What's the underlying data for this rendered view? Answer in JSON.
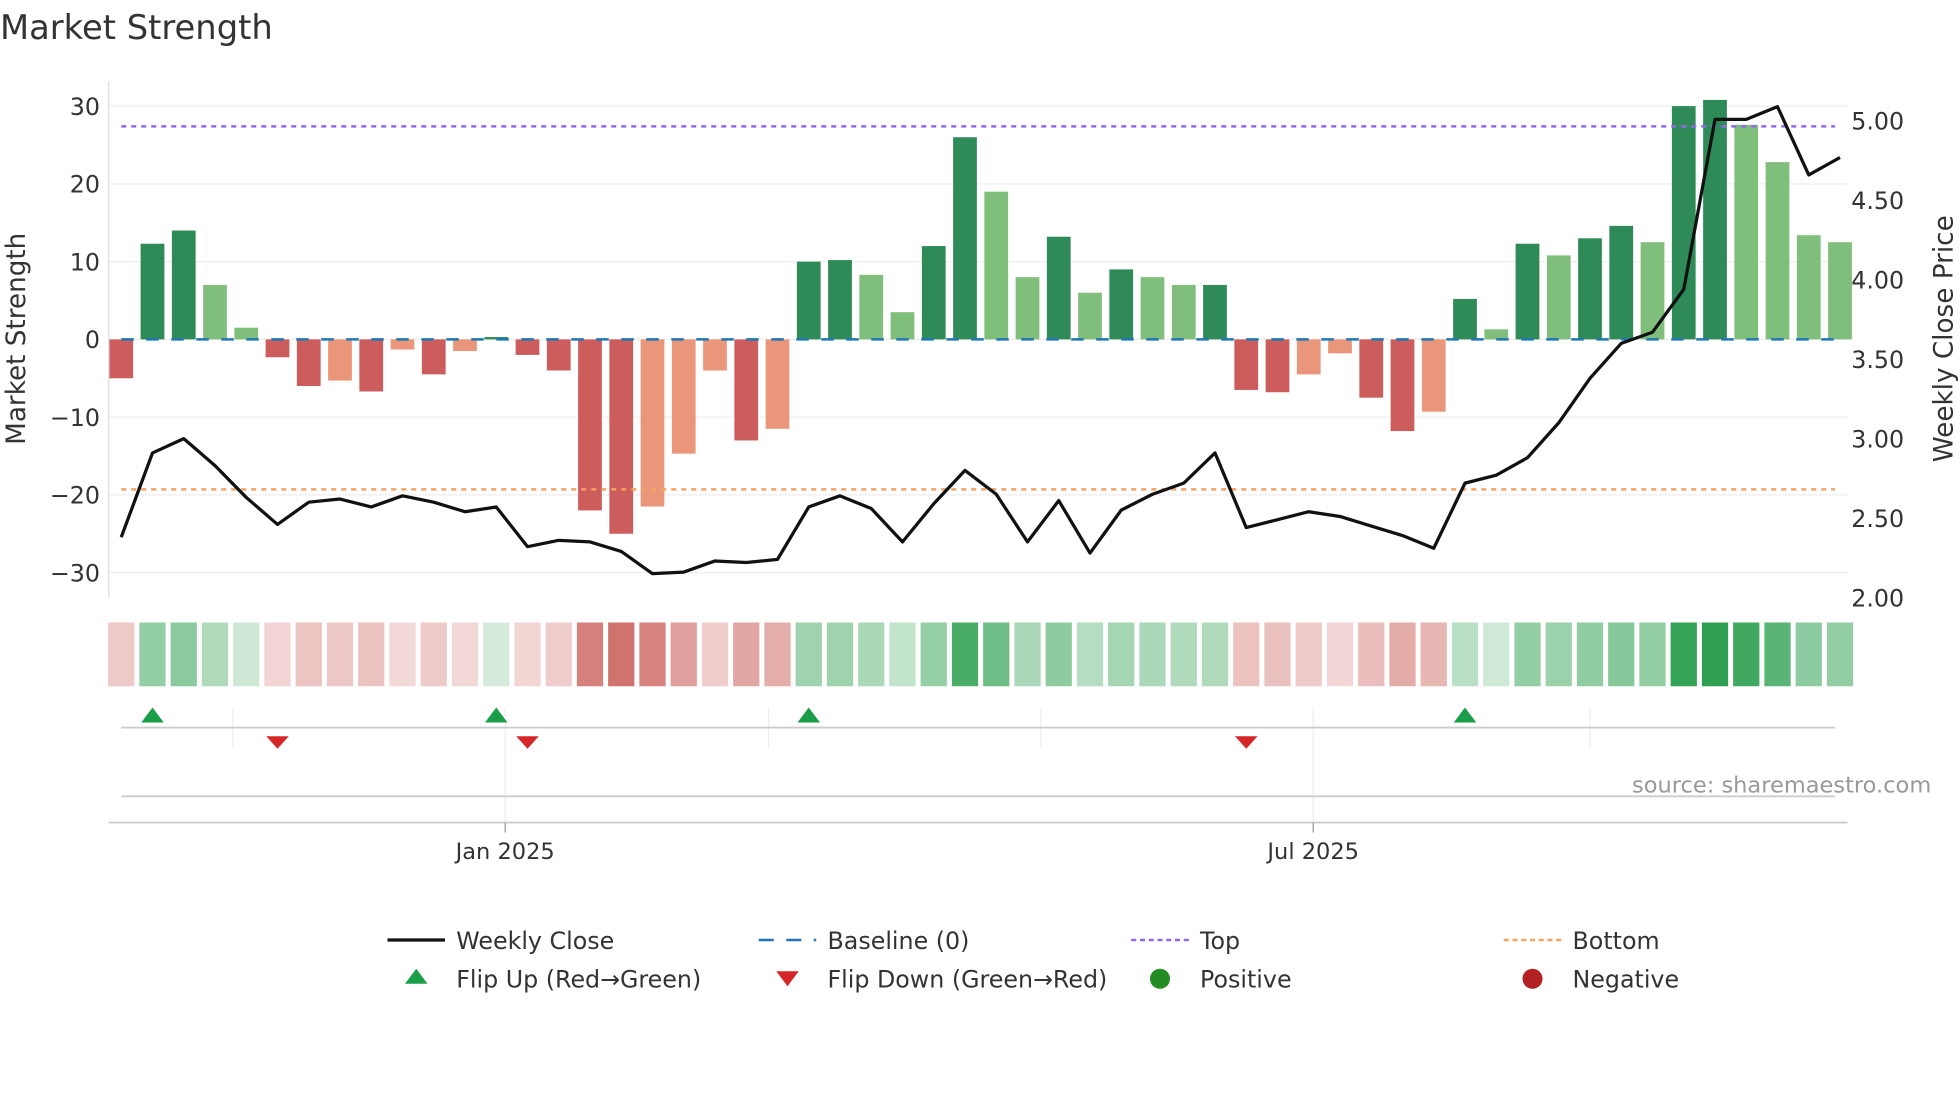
{
  "chart_data": {
    "type": "bar",
    "title": "Market Strength",
    "ylabel": "Market Strength",
    "y2label": "Weekly Close Price",
    "ylim": [
      -33.2,
      33.2
    ],
    "y2lim": [
      2.0,
      5.25
    ],
    "yticks": [
      -30,
      -20,
      -10,
      0,
      10,
      20,
      30
    ],
    "y2ticks": [
      "2.00",
      "2.50",
      "3.00",
      "3.50",
      "4.00",
      "4.50",
      "5.00"
    ],
    "xticks": [
      {
        "label": "Jan 2025",
        "date": "2025-01-01"
      },
      {
        "label": "Jul 2025",
        "date": "2025-07-01"
      }
    ],
    "x_start": "2024-10-07",
    "x_step": "weekly",
    "strength": [
      -5,
      12.3,
      14,
      7,
      1.5,
      -2.3,
      -6,
      -5.3,
      -6.7,
      -1.3,
      -4.5,
      -1.5,
      0.3,
      -2,
      -4,
      -22,
      -25,
      -21.5,
      -14.7,
      -4,
      -13,
      -11.5,
      10,
      10.2,
      8.3,
      3.5,
      12,
      26,
      19,
      8,
      13.2,
      6,
      9,
      8,
      7,
      7,
      -6.5,
      -6.8,
      -4.5,
      -1.8,
      -7.5,
      -11.8,
      -9.3,
      5.2,
      1.3,
      12.3,
      10.8,
      13,
      14.6,
      12.5,
      30,
      30.8,
      27.6,
      22.8,
      13.4,
      12.5
    ],
    "close": [
      2.38,
      2.91,
      3.0,
      2.83,
      2.63,
      2.46,
      2.6,
      2.62,
      2.57,
      2.64,
      2.6,
      2.54,
      2.57,
      2.32,
      2.36,
      2.35,
      2.29,
      2.15,
      2.16,
      2.23,
      2.22,
      2.24,
      2.57,
      2.64,
      2.56,
      2.35,
      2.59,
      2.8,
      2.65,
      2.35,
      2.61,
      2.28,
      2.55,
      2.65,
      2.72,
      2.91,
      2.44,
      2.49,
      2.54,
      2.51,
      2.45,
      2.39,
      2.31,
      2.72,
      2.77,
      2.88,
      3.1,
      3.38,
      3.6,
      3.67,
      3.94,
      5.01,
      5.01,
      5.09,
      4.66,
      4.77
    ],
    "baseline": 0,
    "top": 27.4,
    "bottom": -19.3,
    "flip_up_index": [
      1,
      12,
      22,
      43
    ],
    "flip_down_index": [
      5,
      13,
      36
    ],
    "grid": true,
    "legend_placement": "bottom",
    "legend": [
      {
        "label": "Weekly Close",
        "style": "line"
      },
      {
        "label": "Baseline (0)",
        "style": "dash"
      },
      {
        "label": "Top",
        "style": "dot"
      },
      {
        "label": "Bottom",
        "style": "dot"
      },
      {
        "label": "Flip Up (Red→Green)",
        "style": "triangle-up"
      },
      {
        "label": "Flip Down (Green→Red)",
        "style": "triangle-down"
      },
      {
        "label": "Positive",
        "style": "circle"
      },
      {
        "label": "Negative",
        "style": "circle"
      }
    ],
    "source": "source: sharemaestro.com",
    "colors": {
      "pos_strong": "#2e8b57",
      "pos_weak": "#7fbf7b",
      "neg_strong": "#cd5c5c",
      "neg_weak": "#e9967a",
      "close": "#111111",
      "baseline": "#1f77b4",
      "top": "#9467f0",
      "bottom": "#f4a261",
      "flip_up": "#1a9e4a",
      "flip_down": "#d62728",
      "positive": "#228b22",
      "negative": "#b22222"
    }
  }
}
